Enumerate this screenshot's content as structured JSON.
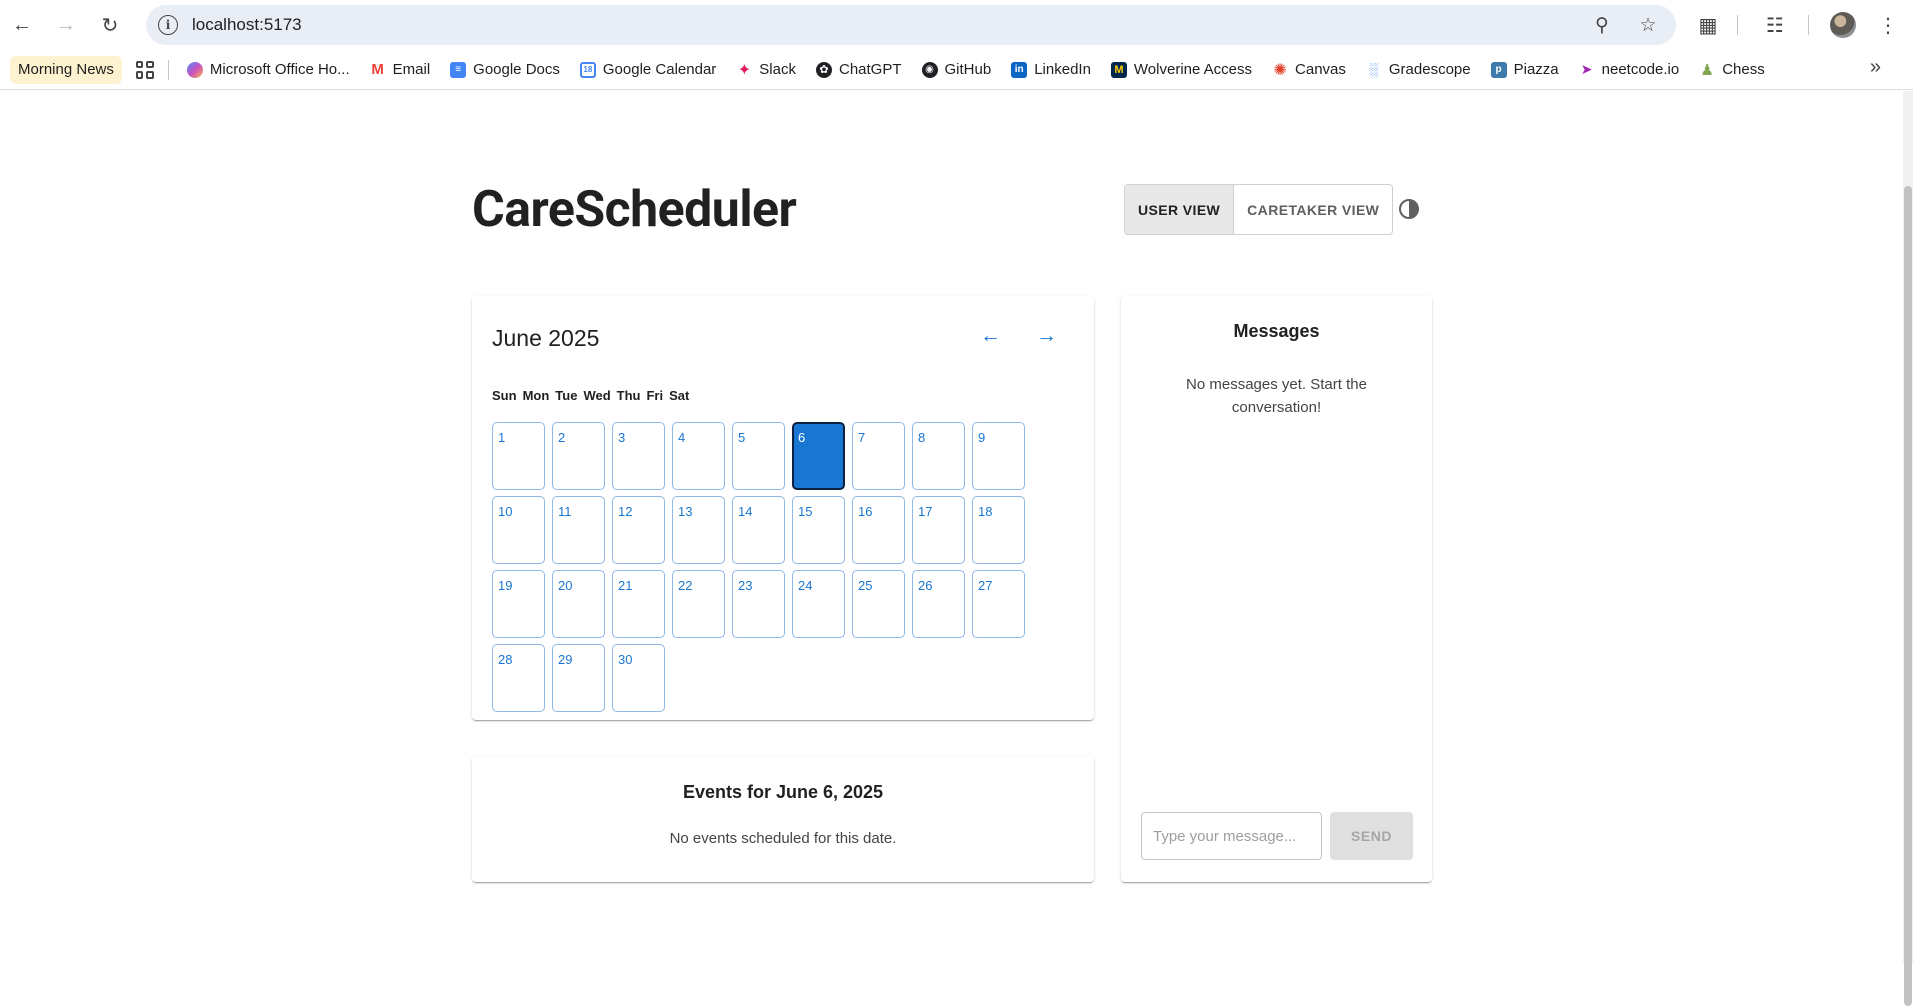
{
  "browser": {
    "url": "localhost:5173",
    "bookmarks": [
      {
        "label": "Morning News",
        "icon": "news-icon",
        "color": "#fdf3d0"
      },
      {
        "label": "Microsoft Office Ho...",
        "icon": "copilot-icon",
        "color": "#7b61ff"
      },
      {
        "label": "Email",
        "icon": "gmail-icon",
        "color": "#ea4335"
      },
      {
        "label": "Google Docs",
        "icon": "docs-icon",
        "color": "#4285f4"
      },
      {
        "label": "Google Calendar",
        "icon": "calendar-icon",
        "color": "#4285f4"
      },
      {
        "label": "Slack",
        "icon": "slack-icon",
        "color": "#e01e5a"
      },
      {
        "label": "ChatGPT",
        "icon": "chatgpt-icon",
        "color": "#202124"
      },
      {
        "label": "GitHub",
        "icon": "github-icon",
        "color": "#202124"
      },
      {
        "label": "LinkedIn",
        "icon": "linkedin-icon",
        "color": "#0a66c2"
      },
      {
        "label": "Wolverine Access",
        "icon": "michigan-icon",
        "color": "#00274c"
      },
      {
        "label": "Canvas",
        "icon": "canvas-icon",
        "color": "#e13f2b"
      },
      {
        "label": "Gradescope",
        "icon": "gradescope-icon",
        "color": "#1a73e8"
      },
      {
        "label": "Piazza",
        "icon": "piazza-icon",
        "color": "#3e7aab"
      },
      {
        "label": "neetcode.io",
        "icon": "rocket-icon",
        "color": "#9c27b0"
      },
      {
        "label": "Chess",
        "icon": "chess-pawn-icon",
        "color": "#7fa650"
      }
    ]
  },
  "app": {
    "title": "CareScheduler",
    "views": {
      "user": "USER VIEW",
      "caretaker": "CARETAKER VIEW",
      "active": "user"
    }
  },
  "calendar": {
    "month_label": "June 2025",
    "prev_label": "←",
    "next_label": "→",
    "weekdays": [
      "Sun",
      "Mon",
      "Tue",
      "Wed",
      "Thu",
      "Fri",
      "Sat"
    ],
    "days": [
      "1",
      "2",
      "3",
      "4",
      "5",
      "6",
      "7",
      "8",
      "9",
      "10",
      "11",
      "12",
      "13",
      "14",
      "15",
      "16",
      "17",
      "18",
      "19",
      "20",
      "21",
      "22",
      "23",
      "24",
      "25",
      "26",
      "27",
      "28",
      "29",
      "30"
    ],
    "selected_day": "6",
    "accent": "#1976d2"
  },
  "events": {
    "title": "Events for June 6, 2025",
    "empty_text": "No events scheduled for this date."
  },
  "messages": {
    "title": "Messages",
    "empty_text": "No messages yet. Start the conversation!",
    "input_placeholder": "Type your message...",
    "send_label": "SEND"
  }
}
